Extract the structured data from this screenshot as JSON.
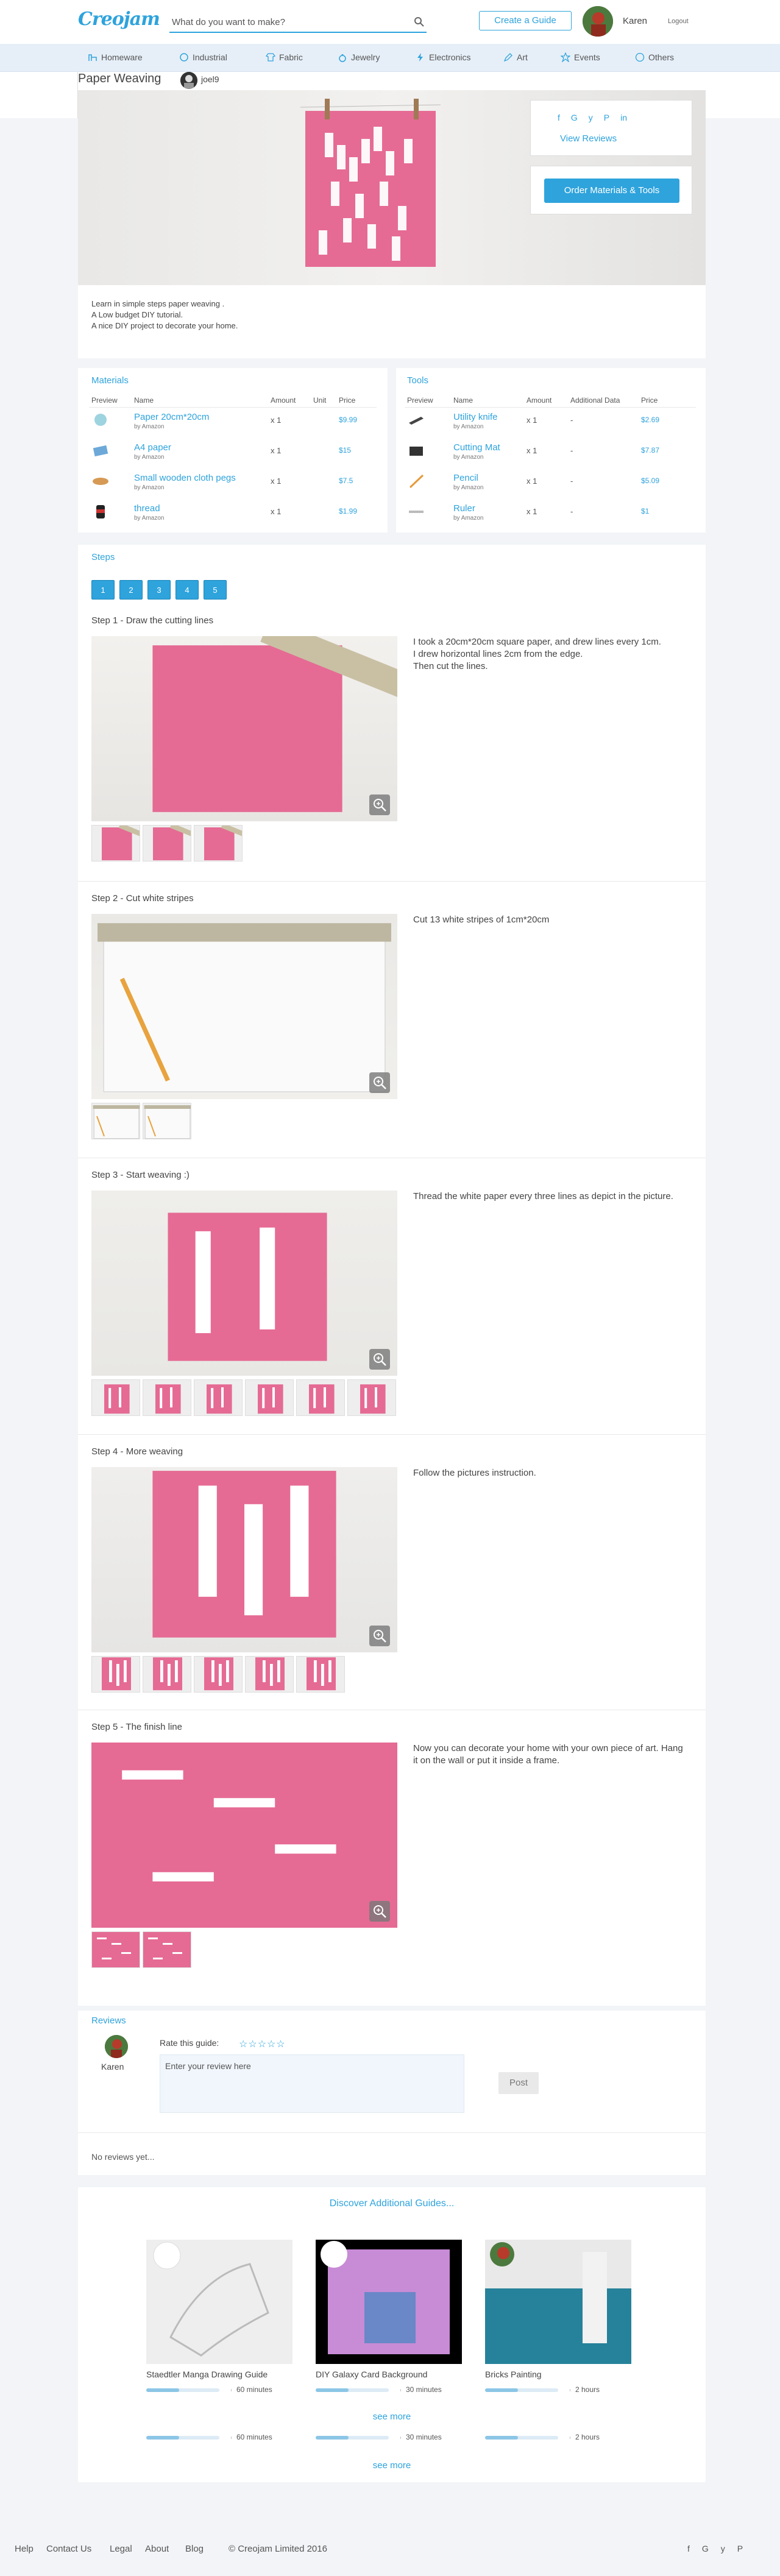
{
  "brand": "Creojam",
  "search": {
    "placeholder": "What do you want to make?"
  },
  "header": {
    "create_label": "Create a Guide",
    "user_name": "Karen",
    "logout_label": "Logout"
  },
  "nav": [
    "Homeware",
    "Industrial",
    "Fabric",
    "Jewelry",
    "Electronics",
    "Art",
    "Events",
    "Others"
  ],
  "guide": {
    "title": "Paper Weaving",
    "author": "joel9",
    "view_reviews": "View Reviews",
    "order_label": "Order Materials & Tools",
    "description": [
      "Learn in simple steps paper weaving .",
      "A Low budget DIY tutorial.",
      "A nice DIY project to decorate your home."
    ]
  },
  "materials": {
    "heading": "Materials",
    "headers": [
      "Preview",
      "Name",
      "Amount",
      "Unit",
      "Price"
    ],
    "items": [
      {
        "name": "Paper 20cm*20cm",
        "by": "by Amazon",
        "amount": "x 1",
        "price": "$9.99"
      },
      {
        "name": "A4 paper",
        "by": "by Amazon",
        "amount": "x 1",
        "price": "$15"
      },
      {
        "name": "Small wooden cloth pegs",
        "by": "by Amazon",
        "amount": "x 1",
        "price": "$7.5"
      },
      {
        "name": "thread",
        "by": "by Amazon",
        "amount": "x 1",
        "price": "$1.99"
      }
    ]
  },
  "tools": {
    "heading": "Tools",
    "headers": [
      "Preview",
      "Name",
      "Amount",
      "Additional Data",
      "Price"
    ],
    "items": [
      {
        "name": "Utility knife",
        "by": "by Amazon",
        "amount": "x 1",
        "extra": "-",
        "price": "$2.69"
      },
      {
        "name": "Cutting Mat",
        "by": "by Amazon",
        "amount": "x 1",
        "extra": "-",
        "price": "$7.87"
      },
      {
        "name": "Pencil",
        "by": "by Amazon",
        "amount": "x 1",
        "extra": "-",
        "price": "$5.09"
      },
      {
        "name": "Ruler",
        "by": "by Amazon",
        "amount": "x 1",
        "extra": "-",
        "price": "$1"
      }
    ]
  },
  "steps_heading": "Steps",
  "pages": [
    "1",
    "2",
    "3",
    "4",
    "5"
  ],
  "steps": [
    {
      "title": "Step 1 - Draw the cutting lines",
      "text": "I took a 20cm*20cm square paper, and drew lines every 1cm.\nI drew horizontal lines 2cm from the edge.\nThen cut the lines."
    },
    {
      "title": "Step 2 - Cut white stripes",
      "text": "Cut 13 white stripes of 1cm*20cm"
    },
    {
      "title": "Step 3 - Start weaving :)",
      "text": "Thread the white paper every three lines as depict in the picture."
    },
    {
      "title": "Step 4 - More weaving",
      "text": "Follow the pictures instruction."
    },
    {
      "title": "Step 5 - The finish line",
      "text": "Now you can decorate your home with your own piece of art. Hang it on the wall or put it inside a frame."
    }
  ],
  "reviews": {
    "heading": "Reviews",
    "reviewer": "Karen",
    "rate_label": "Rate this guide:",
    "stars": "☆☆☆☆☆",
    "placeholder": "Enter your review here",
    "post_label": "Post",
    "empty": "No reviews yet..."
  },
  "discover": {
    "heading": "Discover Additional Guides...",
    "guides": [
      {
        "title": "Staedtler Manga Drawing Guide",
        "duration": "60 minutes"
      },
      {
        "title": "DIY Galaxy Card Background",
        "duration": "30 minutes"
      },
      {
        "title": "Bricks Painting",
        "duration": "2 hours"
      }
    ],
    "more_row": [
      {
        "duration": "60 minutes"
      },
      {
        "duration": "30 minutes"
      },
      {
        "duration": "2 hours"
      }
    ],
    "see_more": "see more"
  },
  "footer": {
    "links": [
      "Help",
      "Contact Us",
      "Legal",
      "About",
      "Blog"
    ],
    "copyright": "© Creojam Limited 2016"
  },
  "colors": {
    "accent": "#2ea3dc",
    "pink": "#e56b94",
    "background": "#f2f4f7"
  }
}
